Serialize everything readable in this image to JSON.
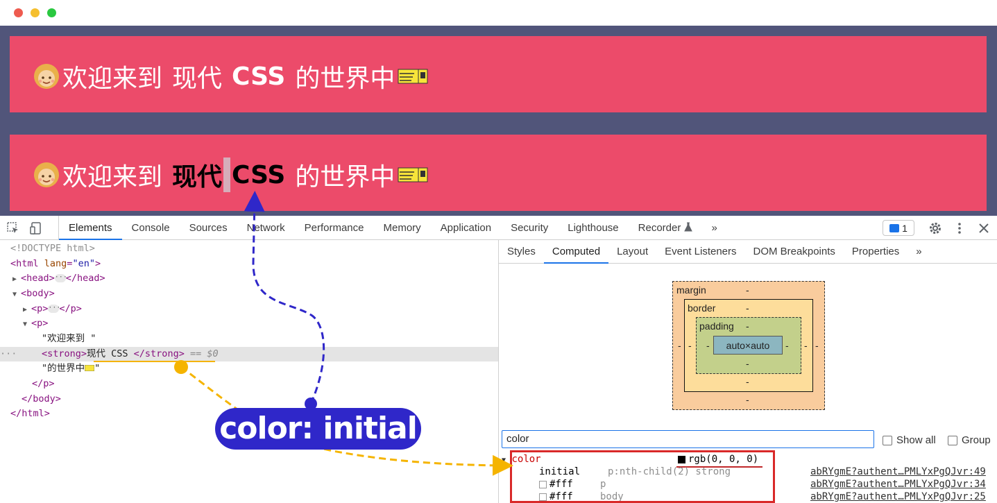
{
  "page": {
    "banner_parts": {
      "prefix": "欢迎来到",
      "modern": "现代",
      "css": "CSS",
      "suffix": "的世界中"
    },
    "emoji_icon": "girl-emoji-icon",
    "ticket_icon": "ticket-emoji-icon"
  },
  "devtools": {
    "tabs": [
      "Elements",
      "Console",
      "Sources",
      "Network",
      "Performance",
      "Memory",
      "Application",
      "Security",
      "Lighthouse",
      "Recorder"
    ],
    "active_tab": "Elements",
    "more": "»",
    "issues_count": "1",
    "elements_lines": {
      "doctype": "<!DOCTYPE html>",
      "html_open": "<html",
      "html_attr": "lang",
      "html_attr_val": "\"en\"",
      "head_open": "<head>",
      "head_close": "</head>",
      "body_open": "<body>",
      "p1_open": "<p>",
      "p1_close": "</p>",
      "p2_open": "<p>",
      "text1": "\"欢迎来到 \"",
      "strong_open": "<strong>",
      "strong_text": "现代 CSS ",
      "strong_close": "</strong>",
      "dollar": "== $0",
      "text2_a": "\"的世界中",
      "text2_b": "\"",
      "p2_close": "</p>",
      "body_close": "</body>",
      "html_close": "</html>",
      "dots": "···"
    },
    "side_tabs": [
      "Styles",
      "Computed",
      "Layout",
      "Event Listeners",
      "DOM Breakpoints",
      "Properties"
    ],
    "side_active": "Computed",
    "box_model": {
      "margin": "margin",
      "border": "border",
      "padding": "padding",
      "content": "auto×auto",
      "dash": "-"
    },
    "filter_value": "color",
    "show_all": "Show all",
    "group": "Group",
    "computed": {
      "prop": "color",
      "value": "rgb(0, 0, 0)",
      "rows": [
        {
          "value": "initial",
          "selector": "p:nth-child(2) strong",
          "source": "abRYgmE?authent…PMLYxPgQJvr:49"
        },
        {
          "value": "#fff",
          "selector": "p",
          "source": "abRYgmE?authent…PMLYxPgQJvr:34"
        },
        {
          "value": "#fff",
          "selector": "body",
          "source": "abRYgmE?authent…PMLYxPgQJvr:25"
        }
      ]
    }
  },
  "annotation": {
    "text": "color: initial"
  },
  "colors": {
    "viewport_bg": "#51557a",
    "banner_bg": "#ec4b6a",
    "annotation_bg": "#2f27c9",
    "arrow_blue": "#2f27c9",
    "arrow_yellow": "#f5b400",
    "highlight_red": "#d92929"
  }
}
